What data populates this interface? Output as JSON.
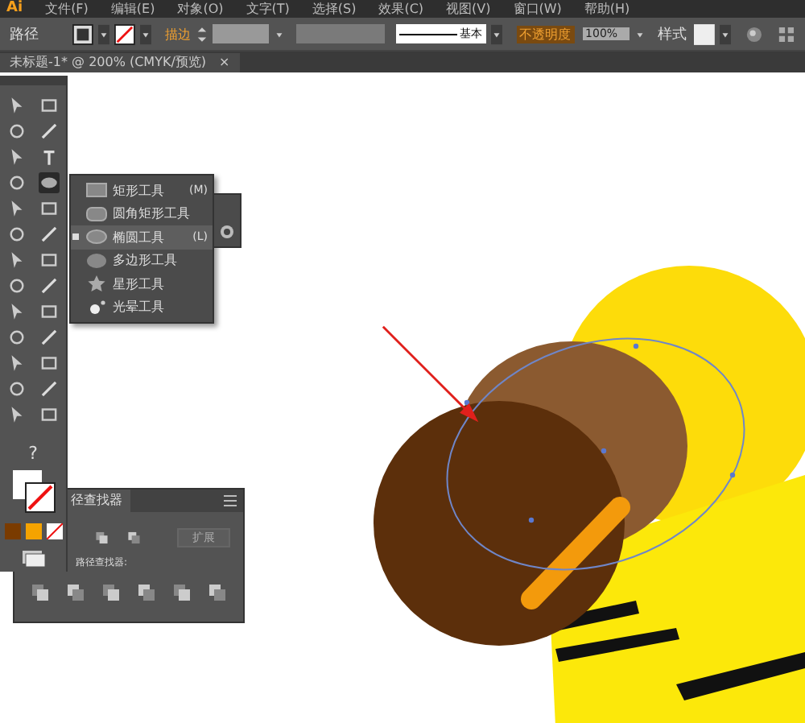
{
  "app": {
    "logo": "Ai"
  },
  "menu": [
    "文件(F)",
    "编辑(E)",
    "对象(O)",
    "文字(T)",
    "选择(S)",
    "效果(C)",
    "视图(V)",
    "窗口(W)",
    "帮助(H)"
  ],
  "control_bar": {
    "selection": "路径",
    "stroke_label": "描边",
    "profile": "基本",
    "opacity_label": "不透明度",
    "opacity": "100%",
    "style_label": "样式"
  },
  "document_tab": {
    "title": "未标题-1* @ 200% (CMYK/预览)",
    "close": "×"
  },
  "toolbox": [
    {
      "selected": false
    },
    {
      "selected": false
    },
    {
      "selected": false
    },
    {
      "selected": false
    },
    {
      "selected": false
    },
    {
      "selected": false
    },
    {
      "selected": false
    },
    {
      "selected": true
    },
    {
      "selected": false
    },
    {
      "selected": false
    },
    {
      "selected": false
    },
    {
      "selected": false
    },
    {
      "selected": false
    },
    {
      "selected": false
    },
    {
      "selected": false
    },
    {
      "selected": false
    },
    {
      "selected": false
    },
    {
      "selected": false
    },
    {
      "selected": false
    },
    {
      "selected": false
    },
    {
      "selected": false
    },
    {
      "selected": false
    },
    {
      "selected": false
    },
    {
      "selected": false
    },
    {
      "selected": false
    },
    {
      "selected": false
    }
  ],
  "help_glyph": "?",
  "flyout": [
    {
      "kind": "rect",
      "label": "矩形工具",
      "shortcut": "(M)",
      "selected": false
    },
    {
      "kind": "rounded",
      "label": "圆角矩形工具",
      "selected": false
    },
    {
      "kind": "ellipse",
      "label": "椭圆工具",
      "shortcut": "(L)",
      "selected": true
    },
    {
      "kind": "polygon",
      "label": "多边形工具",
      "selected": false
    },
    {
      "kind": "star",
      "label": "星形工具",
      "selected": false
    },
    {
      "kind": "flare",
      "label": "光晕工具",
      "selected": false
    }
  ],
  "pathfinder": {
    "tab": "径查找器",
    "expand_button": "扩展",
    "label": "路径查找器:"
  }
}
